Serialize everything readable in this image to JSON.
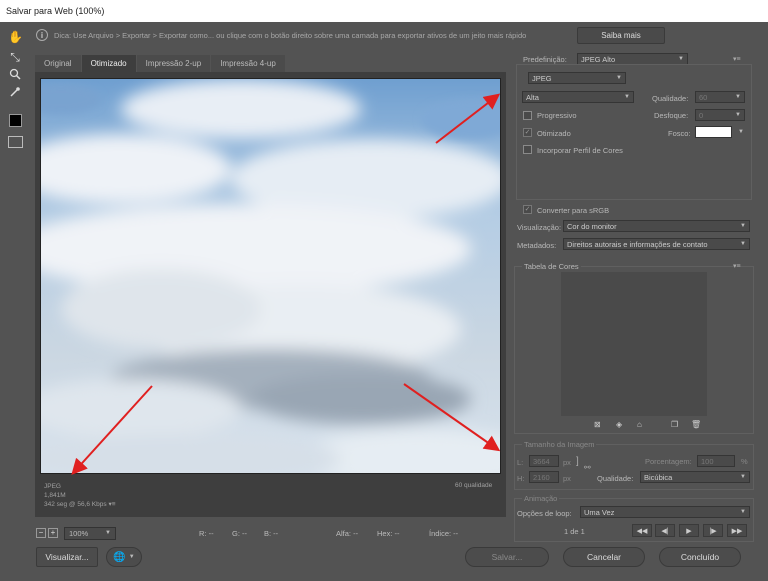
{
  "window": {
    "title": "Salvar para Web (100%)"
  },
  "hint": {
    "text": "Dica: Use Arquivo > Exportar > Exportar como... ou clique com o botão direito sobre uma camada para exportar ativos de um jeito mais rápido",
    "learn_more": "Saiba mais"
  },
  "tabs": [
    {
      "label": "Original",
      "active": false
    },
    {
      "label": "Otimizado",
      "active": true
    },
    {
      "label": "Impressão 2-up",
      "active": false
    },
    {
      "label": "Impressão 4-up",
      "active": false
    }
  ],
  "image_info": {
    "format": "JPEG",
    "size": "1,841M",
    "time": "342 seg @ 56,6 Kbps",
    "menu": "▾≡",
    "quality": "60 qualidade"
  },
  "status": {
    "zoom_minus": "−",
    "zoom_plus": "+",
    "zoom": "100%",
    "r": "R: --",
    "g": "G: --",
    "b": "B: --",
    "alpha": "Alfa: --",
    "hex": "Hex: --",
    "index": "Índice: --"
  },
  "settings": {
    "preset_label": "Predefinição:",
    "preset_value": "JPEG Alto",
    "format_value": "JPEG",
    "quality_preset": "Alta",
    "quality_label": "Qualidade:",
    "quality_value": "60",
    "progressive": "Progressivo",
    "blur_label": "Desfoque:",
    "blur_value": "0",
    "optimized": "Otimizado",
    "matte_label": "Fosco:",
    "embed_profile": "Incorporar Perfil de Cores",
    "convert_srgb": "Converter para sRGB",
    "preview_label": "Visualização:",
    "preview_value": "Cor do monitor",
    "metadata_label": "Metadados:",
    "metadata_value": "Direitos autorais e informações de contato"
  },
  "color_table": {
    "title": "Tabela de Cores"
  },
  "image_size": {
    "title": "Tamanho da Imagem",
    "w_label": "L:",
    "w_value": "3664",
    "h_label": "H:",
    "h_value": "2160",
    "unit": "px",
    "percent_label": "Porcentagem:",
    "percent_value": "100",
    "percent_unit": "%",
    "quality_label": "Qualidade:",
    "quality_value": "Bicúbica"
  },
  "animation": {
    "title": "Animação",
    "loop_label": "Opções de loop:",
    "loop_value": "Uma Vez",
    "frame": "1 de 1"
  },
  "buttons": {
    "preview": "Visualizar...",
    "save": "Salvar...",
    "cancel": "Cancelar",
    "done": "Concluído"
  }
}
